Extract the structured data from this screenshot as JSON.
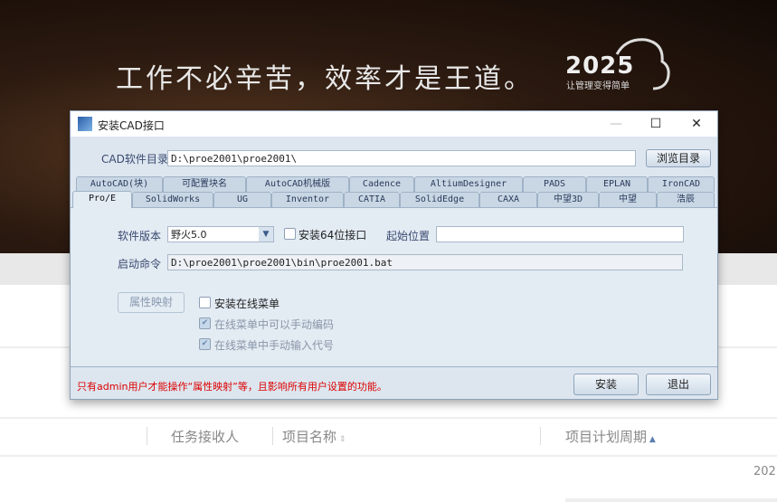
{
  "banner": {
    "slogan": "工作不必辛苦，效率才是王道。",
    "logo_text": "2025",
    "logo_tagline": "让管理变得简单"
  },
  "table": {
    "headers": [
      "任务接收人",
      "项目名称",
      "项目计划周期"
    ],
    "sort_icons": [
      "sort-both-icon",
      "sort-asc-icon"
    ],
    "cell_partial": "202"
  },
  "dialog": {
    "title": "安装CAD接口",
    "window_controls": {
      "minimize": "—",
      "maximize": "☐",
      "close": "✕"
    },
    "cad_dir_label": "CAD软件目录",
    "cad_dir_value": "D:\\proe2001\\proe2001\\",
    "browse_label": "浏览目录",
    "tabs_row1": [
      "AutoCAD(块)",
      "可配置块名",
      "AutoCAD机械版",
      "Cadence",
      "AltiumDesigner",
      "PADS",
      "EPLAN",
      "IronCAD"
    ],
    "tabs_row2": [
      "Pro/E",
      "SolidWorks",
      "UG",
      "Inventor",
      "CATIA",
      "SolidEdge",
      "CAXA",
      "中望3D",
      "中望",
      "浩辰"
    ],
    "selected_tab": "Pro/E",
    "version_label": "软件版本",
    "version_value": "野火5.0",
    "install64_label": "安装64位接口",
    "install64_checked": false,
    "start_pos_label": "起始位置",
    "start_pos_value": "",
    "launch_label": "启动命令",
    "launch_value": "D:\\proe2001\\proe2001\\bin\\proe2001.bat",
    "attr_map_label": "属性映射",
    "online_menu_label": "安装在线菜单",
    "online_menu_checked": false,
    "manual_code_label": "在线菜单中可以手动编码",
    "manual_code_checked": true,
    "manual_input_label": "在线菜单中手动输入代号",
    "manual_input_checked": true,
    "notice": "只有admin用户才能操作“属性映射”等，且影响所有用户设置的功能。",
    "install_label": "安装",
    "exit_label": "退出"
  }
}
